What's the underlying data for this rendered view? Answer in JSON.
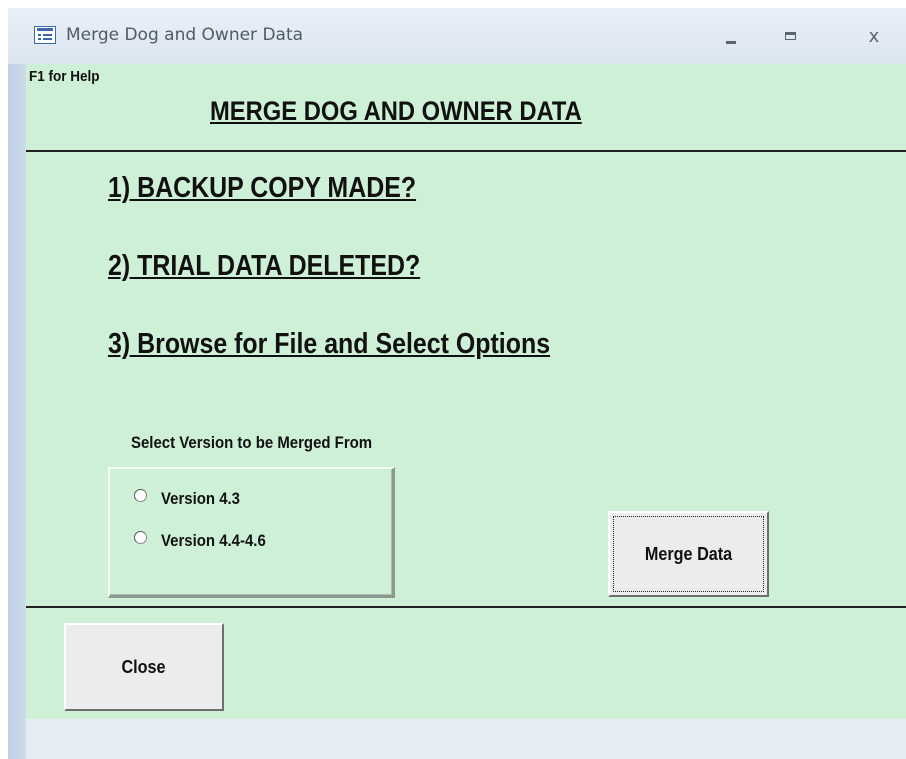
{
  "window": {
    "title": "Merge Dog and Owner Data",
    "controls": {
      "minimize": "–",
      "maximize": "□",
      "close": "x"
    },
    "colors": {
      "form_background": "#cdf0d6",
      "frame": "#dde6f0",
      "button_face": "#ececec"
    }
  },
  "form": {
    "help_text": "F1 for Help",
    "heading": "MERGE DOG AND OWNER DATA",
    "steps": [
      "1) BACKUP COPY MADE?",
      "2) TRIAL DATA DELETED?",
      "3) Browse for File and Select Options"
    ],
    "version_group": {
      "label": "Select Version to be Merged From",
      "options": [
        {
          "label": "Version 4.3",
          "selected": false
        },
        {
          "label": "Version 4.4-4.6",
          "selected": false
        }
      ]
    },
    "merge_button": "Merge Data",
    "close_button": "Close"
  }
}
